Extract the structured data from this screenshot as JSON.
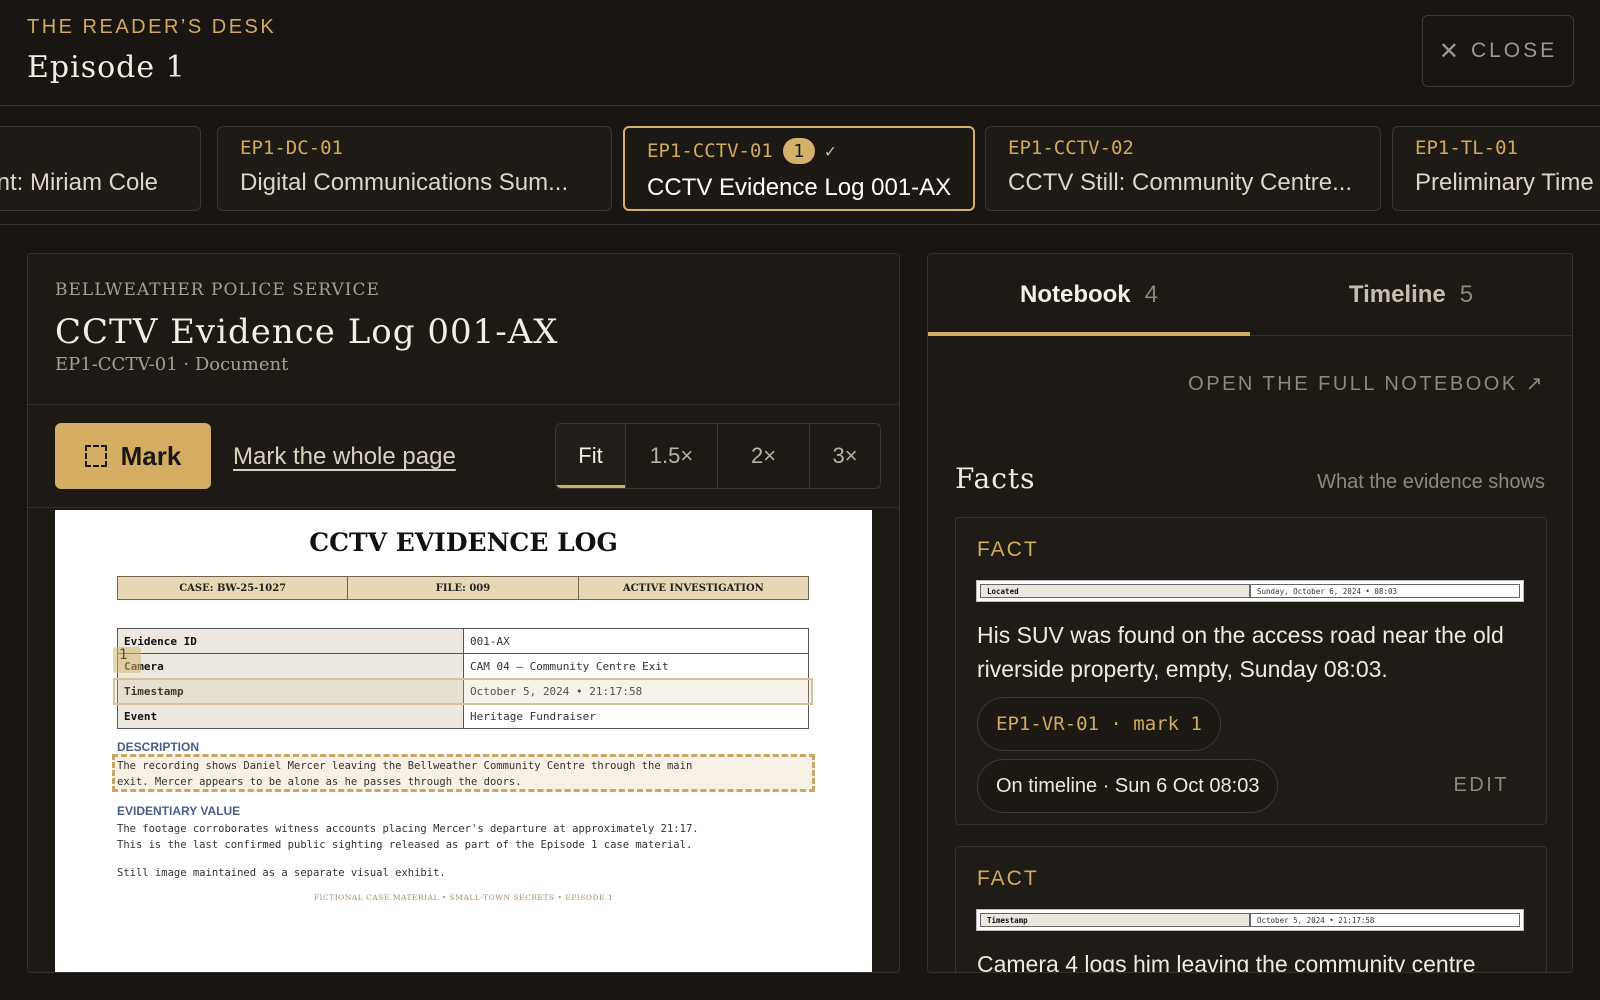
{
  "header": {
    "eyebrow": "THE READER’S DESK",
    "title": "Episode 1",
    "close_label": "CLOSE"
  },
  "doc_tabs": [
    {
      "code": "",
      "label": "ent: Miriam Cole"
    },
    {
      "code": "EP1-DC-01",
      "label": "Digital Communications Sum..."
    },
    {
      "code": "EP1-CCTV-01",
      "badge": "1",
      "check": "✓",
      "label": "CCTV Evidence Log 001-AX",
      "active": true
    },
    {
      "code": "EP1-CCTV-02",
      "label": "CCTV Still: Community Centre..."
    },
    {
      "code": "EP1-TL-01",
      "label": "Preliminary Time"
    }
  ],
  "document": {
    "agency": "BELLWEATHER POLICE SERVICE",
    "title": "CCTV Evidence Log 001-AX",
    "subtitle": "EP1-CCTV-01 · Document"
  },
  "toolbar": {
    "mark_label": "Mark",
    "mark_page_label": "Mark the whole page",
    "zoom_options": [
      "Fit",
      "1.5×",
      "2×",
      "3×"
    ],
    "zoom_selected": "Fit"
  },
  "page": {
    "title": "CCTV EVIDENCE LOG",
    "meta": [
      "CASE: BW-25-1027",
      "FILE: 009",
      "ACTIVE INVESTIGATION"
    ],
    "rows": [
      {
        "label": "Evidence ID",
        "value": "001-AX"
      },
      {
        "label": "Camera",
        "value": "CAM 04 — Community Centre Exit"
      },
      {
        "label": "Timestamp",
        "value": "October 5, 2024 • 21:17:58"
      },
      {
        "label": "Event",
        "value": "Heritage Fundraiser"
      }
    ],
    "marker": "1",
    "description_heading": "DESCRIPTION",
    "description": "The recording shows Daniel Mercer leaving the Bellweather Community Centre through the main\nexit. Mercer appears to be alone as he passes through the doors.",
    "value_heading": "EVIDENTIARY VALUE",
    "value_text": "The footage corroborates witness accounts placing Mercer's departure at approximately 21:17.\nThis is the last confirmed public sighting released as part of the Episode 1 case material.",
    "still_note": "Still image maintained as a separate visual exhibit.",
    "footer": "FICTIONAL CASE MATERIAL • SMALL-TOWN SECRETS • EPISODE 1"
  },
  "right_panel": {
    "tabs": [
      {
        "label": "Notebook",
        "count": "4",
        "active": true
      },
      {
        "label": "Timeline",
        "count": "5"
      }
    ],
    "open_notebook": "OPEN THE FULL NOTEBOOK ↗",
    "facts_heading": "Facts",
    "facts_subheading": "What the evidence shows",
    "facts": [
      {
        "label": "FACT",
        "snippet": [
          "Located",
          "Sunday, October 6, 2024 • 08:03"
        ],
        "text": "His SUV was found on the access road near the old riverside property, empty, Sunday 08:03.",
        "source": "EP1-VR-01 · mark 1",
        "timeline": "On timeline · Sun 6 Oct 08:03",
        "edit": "EDIT"
      },
      {
        "label": "FACT",
        "snippet": [
          "Timestamp",
          "October 5, 2024 • 21:17:58"
        ],
        "text": "Camera 4 logs him leaving the community centre"
      }
    ]
  },
  "colors": {
    "background": "#181512",
    "accent": "#d4ad62",
    "panel": "#1d1a16"
  }
}
